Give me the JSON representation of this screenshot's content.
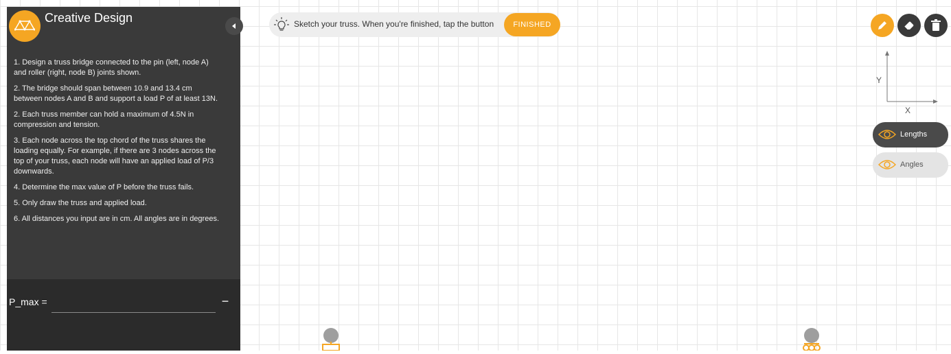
{
  "panel": {
    "title": "Creative Design",
    "instructions": [
      "1. Design a truss bridge connected to the pin (left, node A) and roller (right, node B) joints shown.",
      "2. The bridge should span between 10.9 and 13.4 cm between nodes A and B and support a load P of at least 13N.",
      "2. Each truss member can hold a maximum of 4.5N in compression and tension.",
      "3. Each node across the top chord of the truss shares the loading equally. For example, if there are 3 nodes across the top of your truss, each node will have an applied load of P/3 downwards.",
      "4. Determine the max value of P before the truss fails.",
      "5. Only draw the truss and applied load.",
      "6. All distances you input are in cm. All angles are in degrees."
    ],
    "answer": {
      "label": "P_max =",
      "value": "",
      "minus": "−"
    }
  },
  "hint": {
    "text": "Sketch your truss. When you're finished, tap the button",
    "button_label": "FINISHED"
  },
  "axes": {
    "x_label": "X",
    "y_label": "Y"
  },
  "toggles": {
    "lengths": "Lengths",
    "angles": "Angles"
  },
  "colors": {
    "accent": "#f5a623",
    "panel": "#3a3a3a",
    "panel_dark": "#2b2b2b"
  },
  "icons": {
    "logo": "truss-logo-icon",
    "collapse": "chevron-left-icon",
    "hint": "lightbulb-icon",
    "pencil": "pencil-icon",
    "eraser": "eraser-icon",
    "trash": "trash-icon",
    "eye": "eye-icon",
    "pin": "pin-support-icon",
    "roller": "roller-support-icon"
  }
}
